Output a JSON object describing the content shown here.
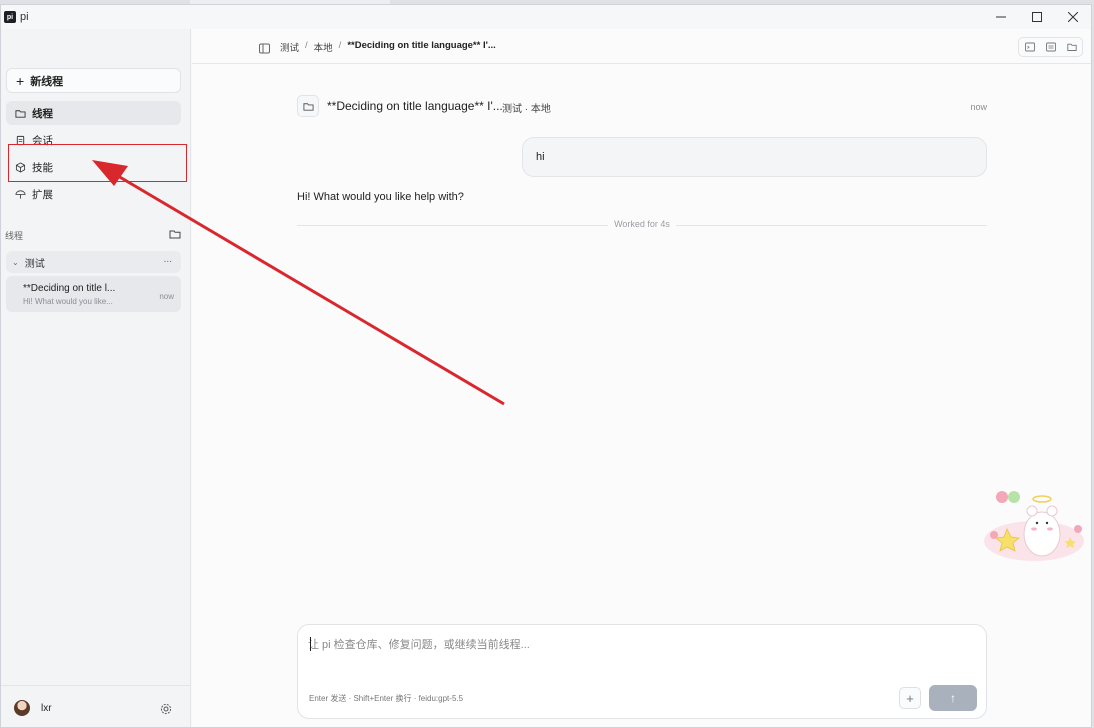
{
  "window": {
    "title": "pi",
    "logo_text": "pi"
  },
  "sidebar": {
    "new_thread_label": "新线程",
    "nav": [
      {
        "label": "线程",
        "icon": "folder-icon",
        "active": true
      },
      {
        "label": "会话",
        "icon": "document-icon",
        "active": false
      },
      {
        "label": "技能",
        "icon": "cube-icon",
        "active": false
      },
      {
        "label": "扩展",
        "icon": "umbrella-icon",
        "active": false
      }
    ],
    "section_label": "线程",
    "group": {
      "name": "测试",
      "more": "..."
    },
    "thread": {
      "title": "**Deciding on title l...",
      "preview": "Hi! What would you like...",
      "time": "now"
    },
    "user": {
      "name": "lxr"
    }
  },
  "topbar": {
    "breadcrumb": [
      "测试",
      "本地",
      "**Deciding on title language** I'..."
    ]
  },
  "conversation": {
    "header_title": "**Deciding on title language** I'...",
    "header_meta": "测试 · 本地",
    "header_time": "now",
    "user_message": "hi",
    "assistant_message": "Hi! What would you like help with?",
    "worked_for": "Worked for 4s"
  },
  "composer": {
    "placeholder": "让 pi 检查仓库、修复问题，或继续当前线程...",
    "hint": "Enter 发送 · Shift+Enter 换行 ·  feidu:gpt-5.5",
    "attach_label": "+",
    "send_label": "↑"
  },
  "colors": {
    "annotation_red": "#d9272e",
    "send_button": "#a9b1bd"
  }
}
